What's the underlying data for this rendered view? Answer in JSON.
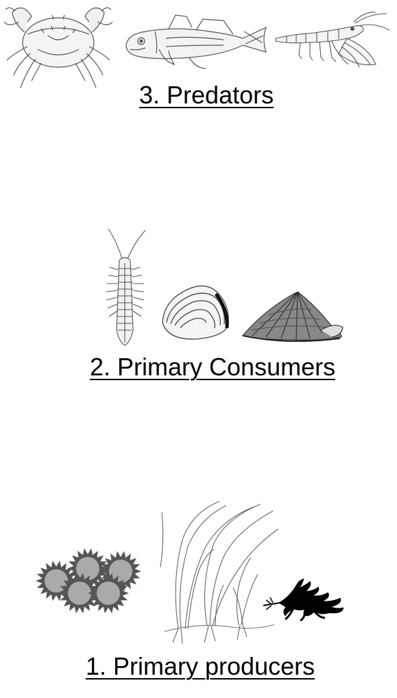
{
  "levels": {
    "predators": {
      "label": "3. Predators",
      "organisms": [
        "crab-illustration",
        "fish-illustration",
        "shrimp-illustration"
      ]
    },
    "primary_consumers": {
      "label": "2. Primary Consumers",
      "organisms": [
        "isopod-illustration",
        "clam-illustration",
        "limpet-illustration"
      ]
    },
    "primary_producers": {
      "label": "1. Primary producers",
      "organisms": [
        "phytoplankton-illustration",
        "seagrass-illustration",
        "seaweed-illustration"
      ]
    }
  },
  "colors": {
    "text": "#000000",
    "sketch": "#555555",
    "phytoplankton_dark": "#555555",
    "phytoplankton_light": "#aaaaaa",
    "seaweed": "#000000"
  }
}
